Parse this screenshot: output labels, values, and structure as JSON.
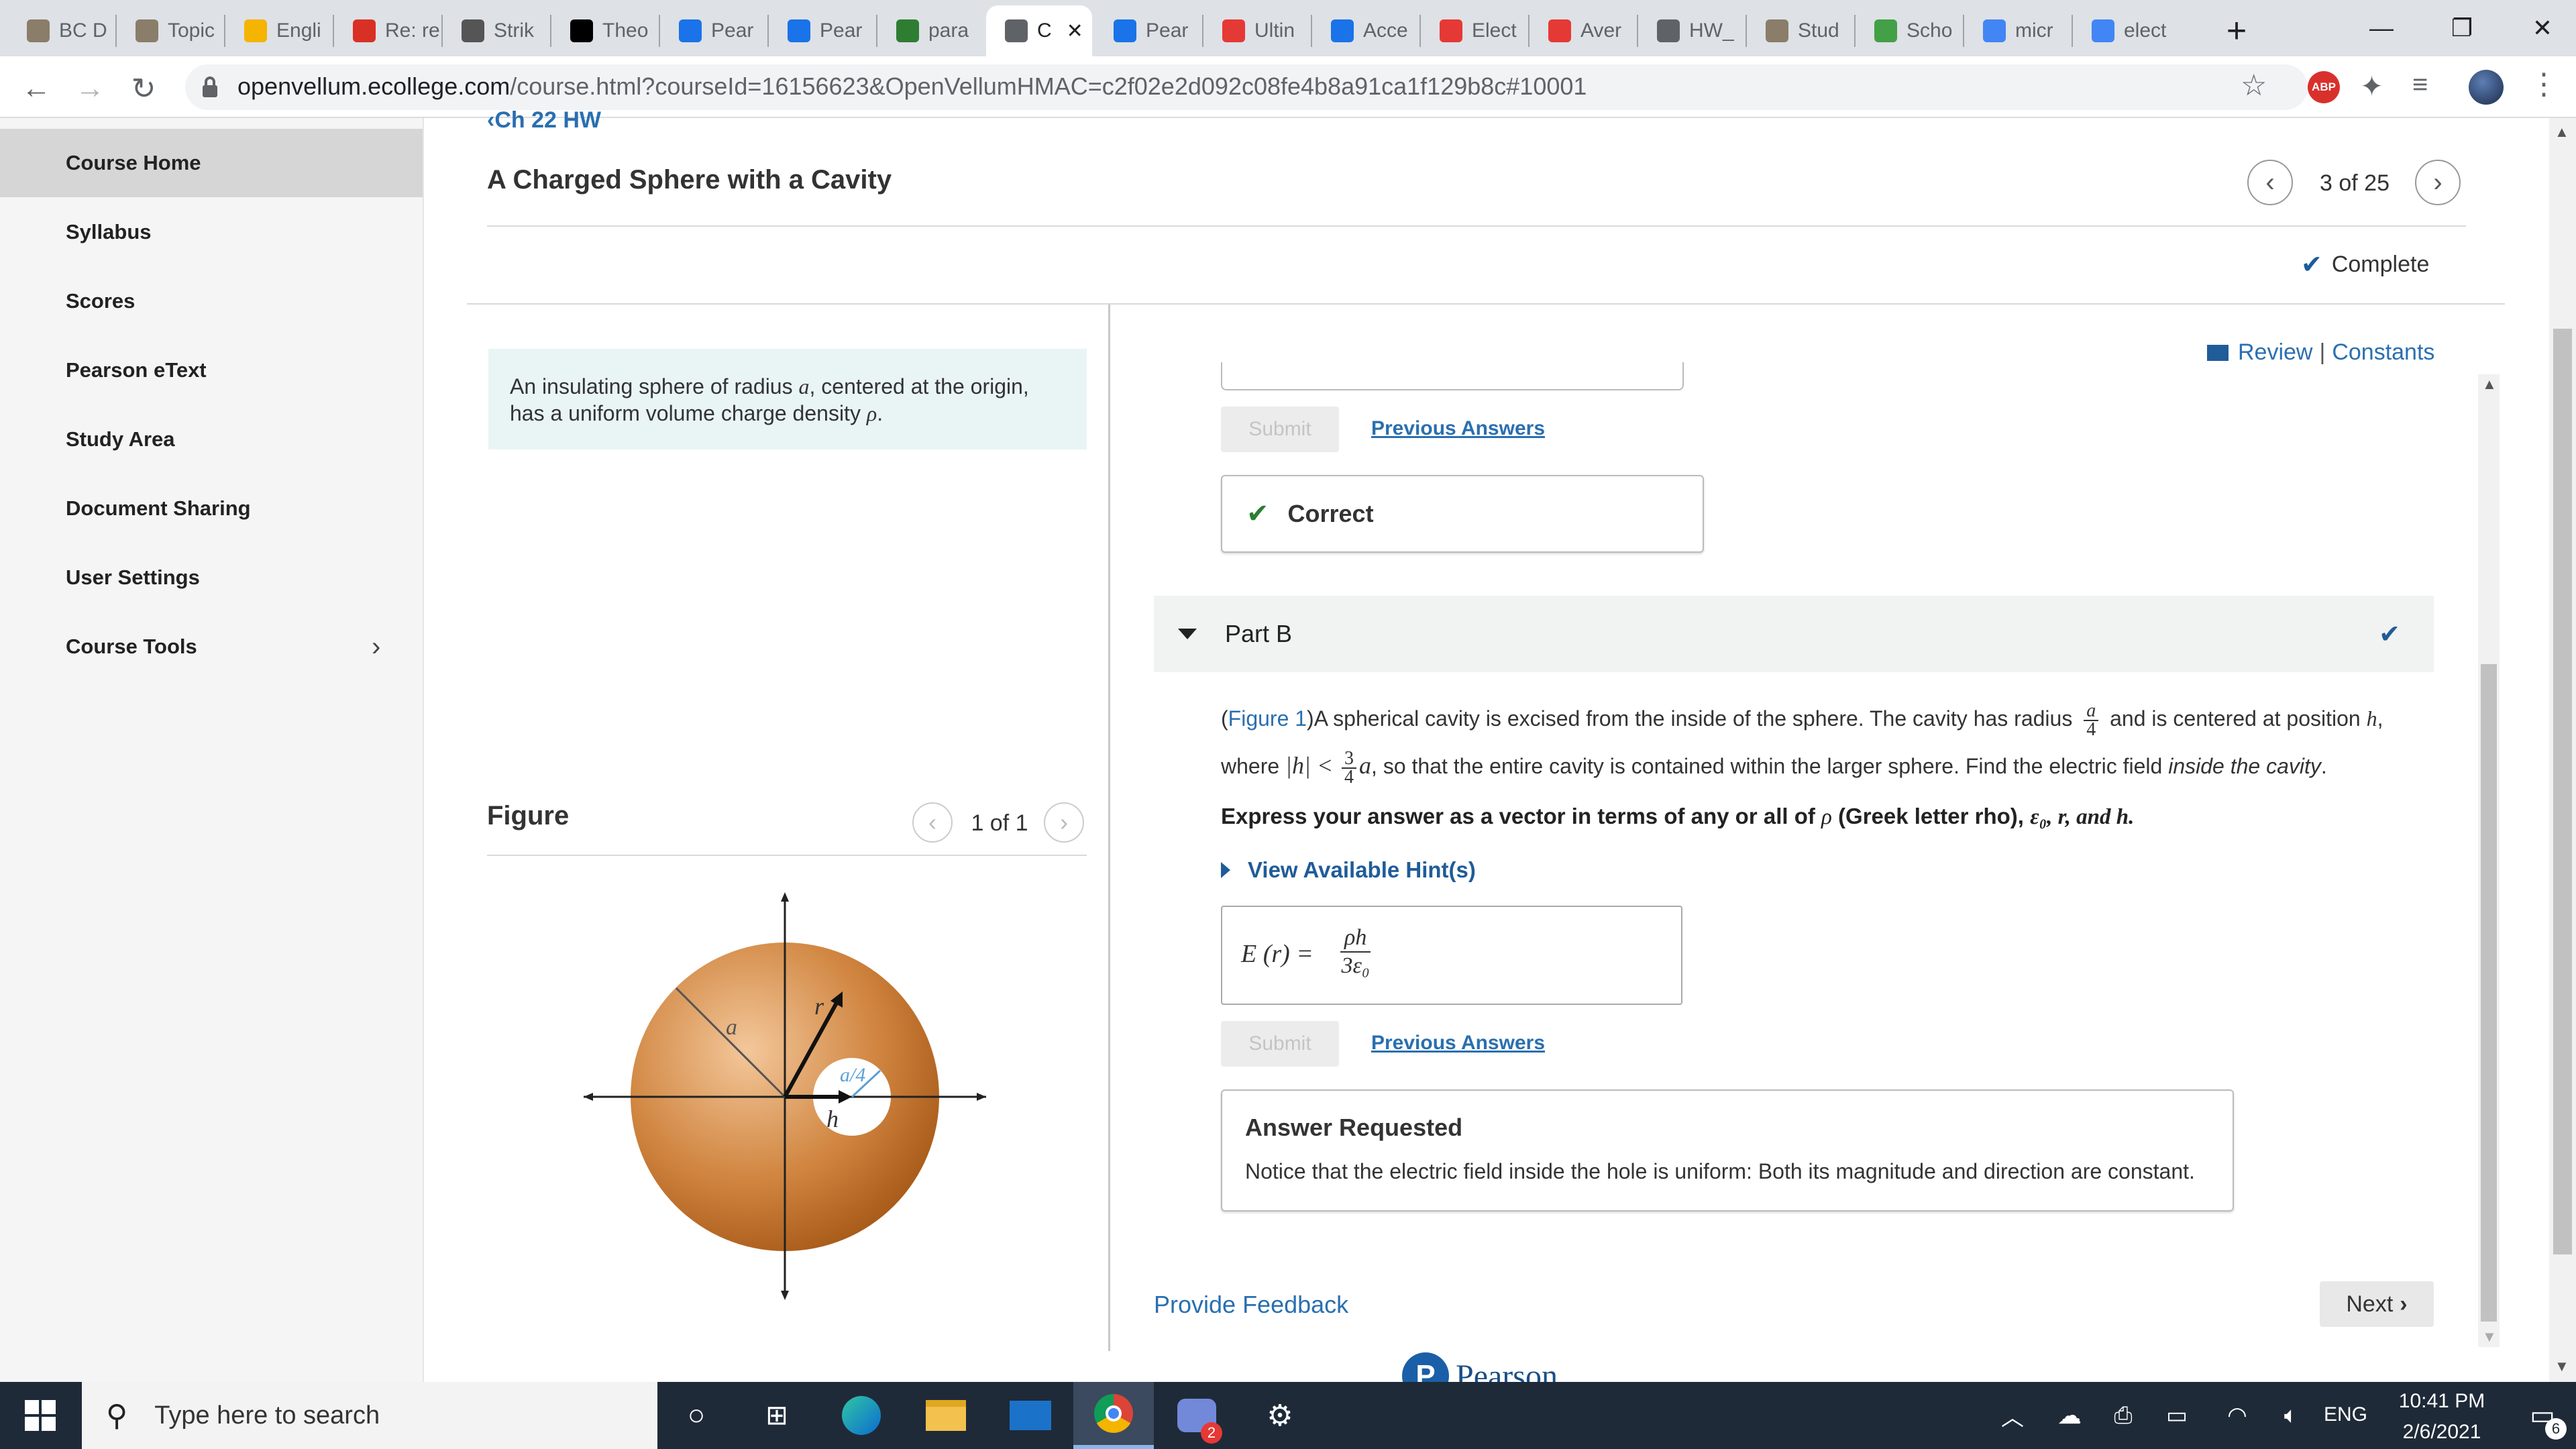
{
  "browser": {
    "tabs": [
      {
        "label": "BC D",
        "icon": "books-icon",
        "color": "#8a7d6a"
      },
      {
        "label": "Topic",
        "icon": "books-icon",
        "color": "#8a7d6a"
      },
      {
        "label": "Engli",
        "icon": "slides-icon",
        "color": "#f4b400"
      },
      {
        "label": "Re: re",
        "icon": "gmail-icon",
        "color": "#d93025"
      },
      {
        "label": "Strik",
        "icon": "image-icon",
        "color": "#555"
      },
      {
        "label": "Theo",
        "icon": "wikipedia-icon",
        "color": "#000"
      },
      {
        "label": "Pear",
        "icon": "pearson-icon",
        "color": "#1a73e8"
      },
      {
        "label": "Pear",
        "icon": "pearson-icon",
        "color": "#1a73e8"
      },
      {
        "label": "para",
        "icon": "leaf-icon",
        "color": "#2e7d32"
      },
      {
        "label": "C",
        "icon": "page-icon",
        "color": "#5f6368"
      },
      {
        "label": "Pear",
        "icon": "pearson-icon",
        "color": "#1a73e8"
      },
      {
        "label": "Ultin",
        "icon": "youtube-icon",
        "color": "#e53935"
      },
      {
        "label": "Acce",
        "icon": "pearson-icon",
        "color": "#1a73e8"
      },
      {
        "label": "Elect",
        "icon": "youtube-icon",
        "color": "#e53935"
      },
      {
        "label": "Aver",
        "icon": "youtube-icon",
        "color": "#e53935"
      },
      {
        "label": "HW_",
        "icon": "globe-icon",
        "color": "#5f6368"
      },
      {
        "label": "Stud",
        "icon": "books-icon",
        "color": "#8a7d6a"
      },
      {
        "label": "Scho",
        "icon": "dollar-icon",
        "color": "#43a047"
      },
      {
        "label": "micr",
        "icon": "google-icon",
        "color": "#4285f4"
      },
      {
        "label": "elect",
        "icon": "google-icon",
        "color": "#4285f4"
      }
    ],
    "active_tab_index": 9,
    "url_host": "openvellum.ecollege.com",
    "url_path": "/course.html?courseId=16156623&OpenVellumHMAC=c2f02e2d092c08fe4b8a91ca1f129b8c#10001",
    "abp_label": "ABP"
  },
  "sidebar": {
    "items": [
      {
        "label": "Course Home"
      },
      {
        "label": "Syllabus"
      },
      {
        "label": "Scores"
      },
      {
        "label": "Pearson eText"
      },
      {
        "label": "Study Area"
      },
      {
        "label": "Document Sharing"
      },
      {
        "label": "User Settings"
      },
      {
        "label": "Course Tools"
      }
    ]
  },
  "header": {
    "back_link": "Ch 22 HW",
    "title": "A Charged Sphere with a Cavity",
    "pager": "3 of 25",
    "status": "Complete"
  },
  "problem": {
    "intro_1": "An insulating sphere of radius ",
    "intro_a": "a",
    "intro_2": ", centered at the origin,",
    "intro_3": "has a uniform volume charge density ",
    "intro_rho": "ρ",
    "intro_4": "."
  },
  "figure": {
    "heading": "Figure",
    "pager": "1 of 1",
    "label_a": "a",
    "label_r": "r",
    "label_h": "h",
    "label_a4": "a/4"
  },
  "links": {
    "review": "Review",
    "sep": "|",
    "constants": "Constants"
  },
  "part_a": {
    "submit": "Submit",
    "previous_answers": "Previous Answers",
    "correct": "Correct"
  },
  "part_b": {
    "title": "Part B",
    "figure_ref": "Figure 1",
    "q1": "A spherical cavity is excised from the inside of the sphere. The cavity has radius",
    "q2": "and is centered at position",
    "q3": "where",
    "q4": ", so that the entire cavity is contained within the larger sphere. Find the electric field",
    "q5": "inside the cavity",
    "express": "Express your answer as a vector in terms of any or all of",
    "express_rho": "ρ",
    "express_2": "(Greek letter rho),",
    "express_vars": "ε₀, r, and h.",
    "hints": "View Available Hint(s)",
    "answer_lhs": "E (r) =",
    "answer_num": "ρh",
    "answer_den": "3ε₀",
    "submit": "Submit",
    "previous_answers": "Previous Answers",
    "answer_requested_title": "Answer Requested",
    "answer_requested_text": "Notice that the electric field inside the hole is uniform: Both its magnitude and direction are constant."
  },
  "footer": {
    "feedback": "Provide Feedback",
    "next": "Next",
    "brand": "Pearson"
  },
  "taskbar": {
    "search_placeholder": "Type here to search",
    "lang": "ENG",
    "time": "10:41 PM",
    "date": "2/6/2021",
    "notif_count": "6",
    "discord_badge": "2"
  },
  "colors": {
    "accent": "#2a6fb0",
    "correct_green": "#2e7d32",
    "sphere": "#c8742c"
  }
}
